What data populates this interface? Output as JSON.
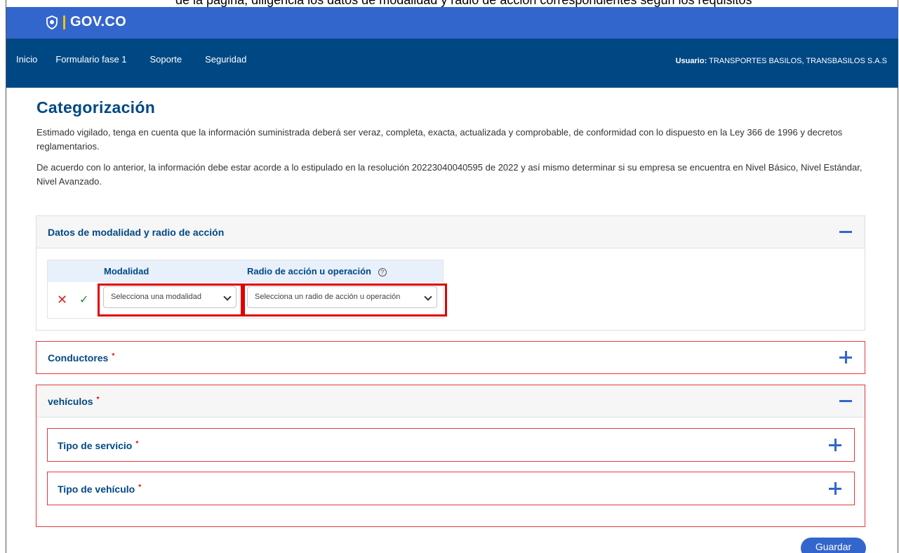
{
  "top_crop_text": "de la página, diligencia los datos de modalidad y radio de acción correspondientes según los requisitos",
  "gov": {
    "logo_text": "GOV.CO"
  },
  "nav": {
    "items": [
      "Inicio",
      "Formulario fase 1",
      "Soporte",
      "Seguridad"
    ],
    "user_label": "Usuario:",
    "user_value": "TRANSPORTES BASILOS, TRANSBASILOS S.A.S"
  },
  "page": {
    "title": "Categorización",
    "paragraph1": "Estimado vigilado, tenga en cuenta que la información suministrada deberá ser veraz, completa, exacta, actualizada y comprobable, de conformidad con lo dispuesto en la Ley 366 de 1996 y decretos reglamentarios.",
    "paragraph2": "De acuerdo con lo anterior, la información debe estar acorde a lo estipulado en la resolución 20223040040595 de 2022 y así mismo determinar si su empresa se encuentra en Nivel Básico, Nivel Estándar, Nivel Avanzado."
  },
  "modalidad_panel": {
    "title": "Datos de modalidad y radio de acción",
    "col_modalidad": "Modalidad",
    "col_radio": "Radio de acción u operación",
    "help_glyph": "?",
    "modalidad_placeholder": "Selecciona una modalidad",
    "radio_placeholder": "Selecciona un radio de acción u operación",
    "highlight_color": "#e00000"
  },
  "conductores_panel": {
    "title": "Conductores",
    "required_mark": "*"
  },
  "vehiculos_panel": {
    "title": "vehículos",
    "required_mark": "*",
    "sub_panels": [
      {
        "title": "Tipo de servicio",
        "required_mark": "*"
      },
      {
        "title": "Tipo de vehículo",
        "required_mark": "*"
      }
    ]
  },
  "actions": {
    "save_label": "Guardar"
  },
  "colors": {
    "gov_blue": "#3366cc",
    "nav_blue": "#004884",
    "error_red": "#e33a3a"
  }
}
